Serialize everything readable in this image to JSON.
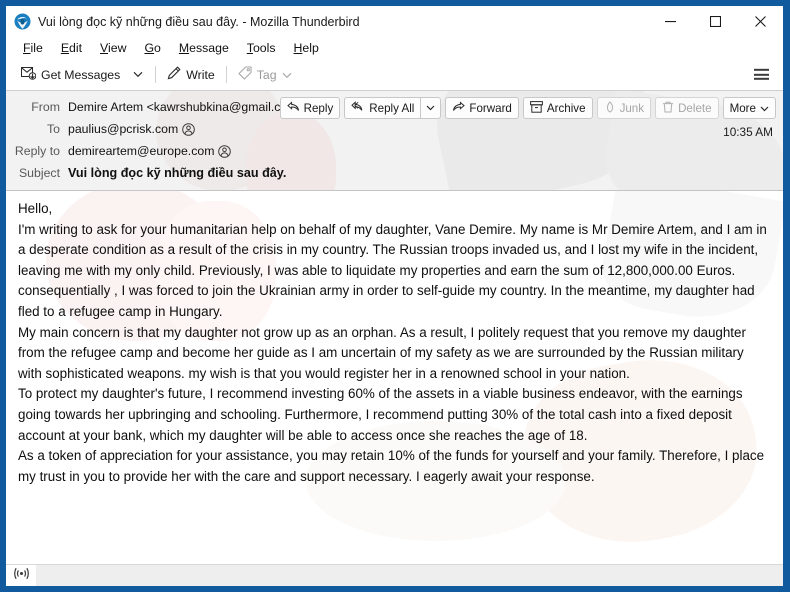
{
  "window": {
    "title": "Vui lòng đọc kỹ những điều sau đây. - Mozilla Thunderbird",
    "app_icon": "thunderbird-icon",
    "minimize_label": "—",
    "maximize_label": "□",
    "close_label": "✕",
    "frame_color": "#125a9e"
  },
  "menubar": {
    "items": [
      {
        "label": "File",
        "accesskey": "F"
      },
      {
        "label": "Edit",
        "accesskey": "E"
      },
      {
        "label": "View",
        "accesskey": "V"
      },
      {
        "label": "Go",
        "accesskey": "G"
      },
      {
        "label": "Message",
        "accesskey": "M"
      },
      {
        "label": "Tools",
        "accesskey": "T"
      },
      {
        "label": "Help",
        "accesskey": "H"
      }
    ]
  },
  "toolbar": {
    "get_messages_label": "Get Messages",
    "get_messages_caret": "⌄",
    "write_label": "Write",
    "tag_label": "Tag",
    "tag_caret": "⌄",
    "tag_disabled": true,
    "app_menu_label": "Application menu"
  },
  "header": {
    "rows": [
      {
        "label": "From",
        "value": "Demire Artem <kawrshubkina@gmail.com>",
        "has_contact_icon": true
      },
      {
        "label": "To",
        "value": "paulius@pcrisk.com",
        "has_contact_icon": true
      },
      {
        "label": "Reply to",
        "value": "demireartem@europe.com",
        "has_contact_icon": true
      }
    ],
    "subject_label": "Subject",
    "subject_value": "Vui lòng đọc kỹ những điều sau đây.",
    "time": "10:35 AM",
    "actions": [
      {
        "label": "Reply",
        "icon": "reply-icon",
        "disabled": false
      },
      {
        "label": "Reply All",
        "icon": "reply-all-icon",
        "disabled": false,
        "caret": "⌄"
      },
      {
        "label": "Forward",
        "icon": "forward-icon",
        "disabled": false
      },
      {
        "label": "Archive",
        "icon": "archive-icon",
        "disabled": false
      },
      {
        "label": "Junk",
        "icon": "junk-icon",
        "disabled": true
      },
      {
        "label": "Delete",
        "icon": "trash-icon",
        "disabled": true
      },
      {
        "label": "More",
        "icon": "chevron-down-icon",
        "disabled": false,
        "caret": "⌄"
      }
    ]
  },
  "message_body": {
    "paragraphs": [
      "Hello,",
      "I'm writing to ask for your humanitarian help on behalf of my daughter, Vane Demire. My name is Mr Demire Artem, and I am in a desperate condition as a result of the crisis in my country. The Russian troops invaded us, and I lost my wife in the incident, leaving me with my only child. Previously, I was able to liquidate my properties and earn the sum of 12,800,000.00 Euros. consequentially , I was forced to join the Ukrainian army in order to self-guide my country. In the meantime, my daughter had fled to a refugee camp in Hungary.",
      "My main concern is that my daughter not grow up as an orphan. As a result, I politely request that you remove my daughter from the refugee camp and  become her guide as I am uncertain of my safety as we are surrounded by the Russian military with sophisticated weapons. my wish is that you would register her in a renowned school in your nation.",
      "To protect my daughter's future, I recommend investing 60% of the assets in a viable business endeavor, with the earnings going towards her upbringing and schooling. Furthermore, I recommend putting 30% of the total cash into a fixed deposit account at your bank, which my daughter will be able to access once she reaches the age of 18.",
      "As a token of appreciation for your assistance, you may retain 10% of the funds for yourself and your family. Therefore, I place my trust in you to provide her with the care and support necessary. I eagerly await your response."
    ]
  },
  "statusbar": {
    "icon": "connection-icon",
    "text": ""
  }
}
